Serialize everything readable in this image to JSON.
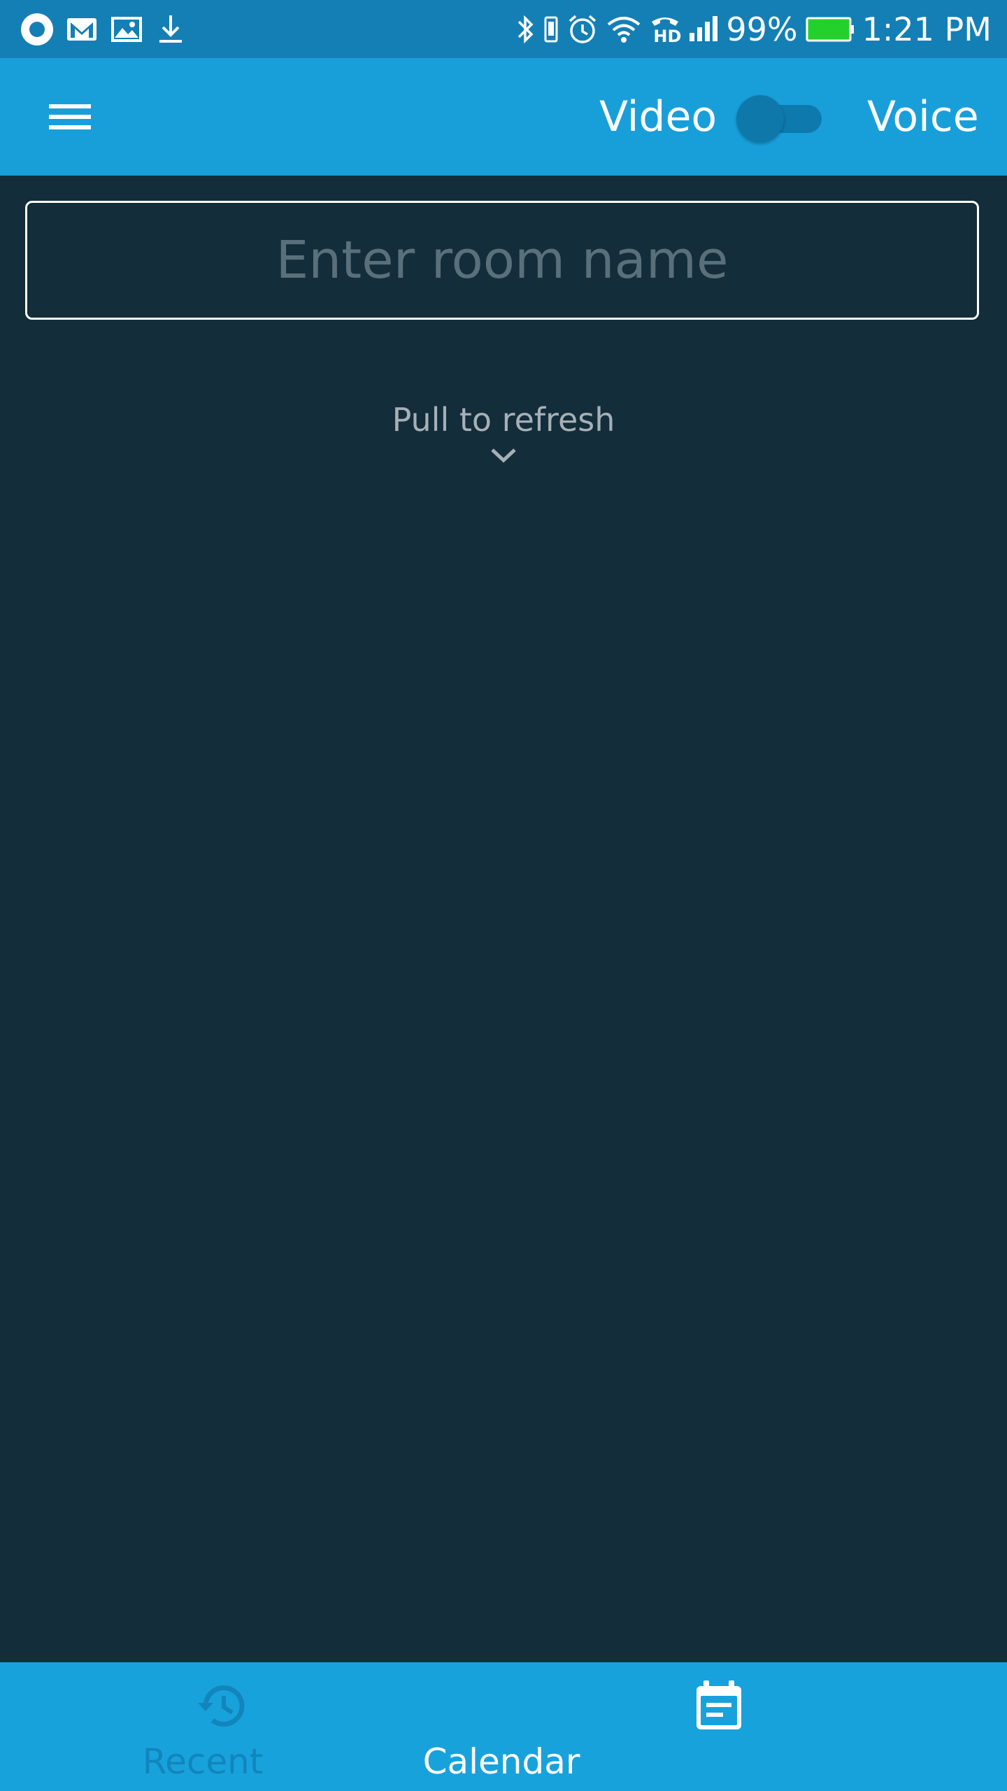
{
  "status_bar": {
    "battery_percent": "99%",
    "time": "1:21 PM",
    "hd_badge": "HD",
    "battery_color": "#22d12b",
    "left_icons": [
      "chrome-icon",
      "gmail-icon",
      "gallery-icon",
      "download-icon"
    ],
    "right_icons": [
      "bluetooth-icon",
      "vibrate-icon",
      "alarm-icon",
      "wifi-icon",
      "hd-call-icon",
      "signal-icon",
      "battery-icon"
    ]
  },
  "app_bar": {
    "menu_icon": "hamburger-menu-icon",
    "mode_left_label": "Video",
    "mode_right_label": "Voice",
    "mode_toggle_on": false
  },
  "room_input": {
    "placeholder": "Enter room name",
    "value": ""
  },
  "refresh_hint": {
    "text": "Pull to refresh",
    "icon": "chevron-down-icon"
  },
  "bottom_nav": {
    "tabs": [
      {
        "label": "Recent",
        "icon": "history-icon",
        "active": false
      },
      {
        "label": "Calendar",
        "icon": "calendar-icon",
        "active": true
      }
    ]
  },
  "colors": {
    "background": "#132d3a",
    "status_bar": "#147fb5",
    "app_bar": "#189fda",
    "bottom_nav": "#18a2dc",
    "inactive_tab": "#1185bc",
    "active_tab": "#ffffff"
  }
}
